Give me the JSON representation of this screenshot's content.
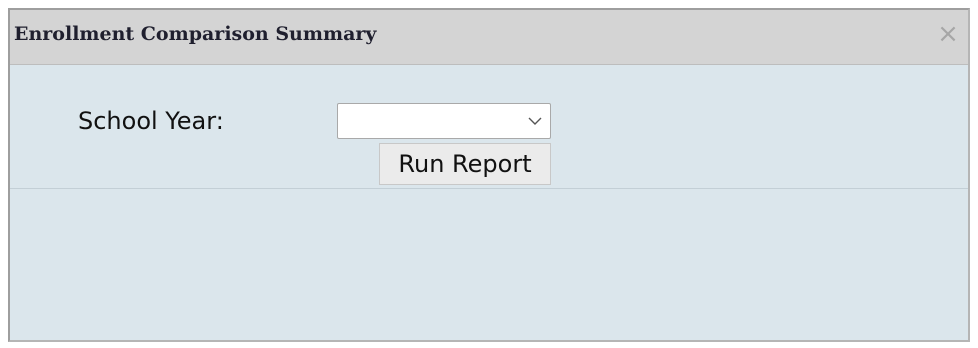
{
  "dialog": {
    "title": "Enrollment Comparison Summary",
    "close_symbol": "×",
    "close_icon": "close-icon"
  },
  "form": {
    "school_year_label": "School Year:",
    "school_year_value": "",
    "chevron_icon": "chevron-down-icon",
    "run_button_label": "Run Report"
  }
}
